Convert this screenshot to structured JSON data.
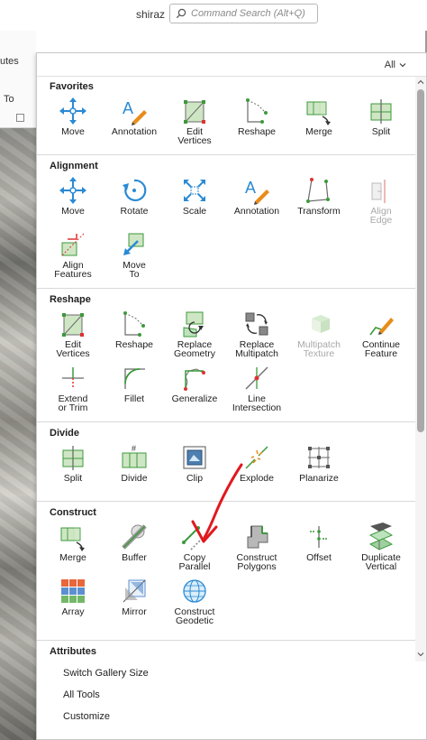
{
  "header": {
    "user": "shiraz",
    "search_placeholder": "Command Search (Alt+Q)"
  },
  "ribbon": {
    "partial_text_1": "utes",
    "partial_text_2": "To"
  },
  "gallery": {
    "filter_label": "All",
    "sections": [
      {
        "title": "Favorites",
        "tools": [
          {
            "label": "Move",
            "icon": "move-icon"
          },
          {
            "label": "Annotation",
            "icon": "annotation-icon"
          },
          {
            "label": "Edit\nVertices",
            "icon": "edit-vertices-icon"
          },
          {
            "label": "Reshape",
            "icon": "reshape-icon"
          },
          {
            "label": "Merge",
            "icon": "merge-icon"
          },
          {
            "label": "Split",
            "icon": "split-icon"
          }
        ]
      },
      {
        "title": "Alignment",
        "tools": [
          {
            "label": "Move",
            "icon": "move-icon"
          },
          {
            "label": "Rotate",
            "icon": "rotate-icon"
          },
          {
            "label": "Scale",
            "icon": "scale-icon"
          },
          {
            "label": "Annotation",
            "icon": "annotation-icon"
          },
          {
            "label": "Transform",
            "icon": "transform-icon"
          },
          {
            "label": "Align\nEdge",
            "icon": "align-edge-icon",
            "disabled": true
          },
          {
            "label": "Align\nFeatures",
            "icon": "align-features-icon"
          },
          {
            "label": "Move\nTo",
            "icon": "move-to-icon"
          }
        ]
      },
      {
        "title": "Reshape",
        "tools": [
          {
            "label": "Edit\nVertices",
            "icon": "edit-vertices-icon"
          },
          {
            "label": "Reshape",
            "icon": "reshape-icon"
          },
          {
            "label": "Replace\nGeometry",
            "icon": "replace-geometry-icon"
          },
          {
            "label": "Replace\nMultipatch",
            "icon": "replace-multipatch-icon"
          },
          {
            "label": "Multipatch\nTexture",
            "icon": "multipatch-texture-icon",
            "disabled": true
          },
          {
            "label": "Continue\nFeature",
            "icon": "continue-feature-icon"
          },
          {
            "label": "Extend\nor Trim",
            "icon": "extend-trim-icon"
          },
          {
            "label": "Fillet",
            "icon": "fillet-icon"
          },
          {
            "label": "Generalize",
            "icon": "generalize-icon"
          },
          {
            "label": "Line\nIntersection",
            "icon": "line-intersection-icon"
          }
        ]
      },
      {
        "title": "Divide",
        "tools": [
          {
            "label": "Split",
            "icon": "split-icon"
          },
          {
            "label": "Divide",
            "icon": "divide-icon"
          },
          {
            "label": "Clip",
            "icon": "clip-icon"
          },
          {
            "label": "Explode",
            "icon": "explode-icon"
          },
          {
            "label": "Planarize",
            "icon": "planarize-icon"
          }
        ]
      },
      {
        "title": "Construct",
        "tools": [
          {
            "label": "Merge",
            "icon": "merge-icon"
          },
          {
            "label": "Buffer",
            "icon": "buffer-icon"
          },
          {
            "label": "Copy\nParallel",
            "icon": "copy-parallel-icon"
          },
          {
            "label": "Construct\nPolygons",
            "icon": "construct-polygons-icon"
          },
          {
            "label": "Offset",
            "icon": "offset-icon"
          },
          {
            "label": "Duplicate\nVertical",
            "icon": "duplicate-vertical-icon"
          },
          {
            "label": "Array",
            "icon": "array-icon"
          },
          {
            "label": "Mirror",
            "icon": "mirror-icon"
          },
          {
            "label": "Construct\nGeodetic",
            "icon": "construct-geodetic-icon"
          }
        ]
      }
    ],
    "attributes_title": "Attributes",
    "menu": [
      "Switch Gallery Size",
      "All Tools",
      "Customize"
    ]
  },
  "colors": {
    "accent_blue": "#2a8ad4",
    "green": "#3c9a3c",
    "red_annotation": "#e0191f",
    "orange": "#e88c1a"
  }
}
